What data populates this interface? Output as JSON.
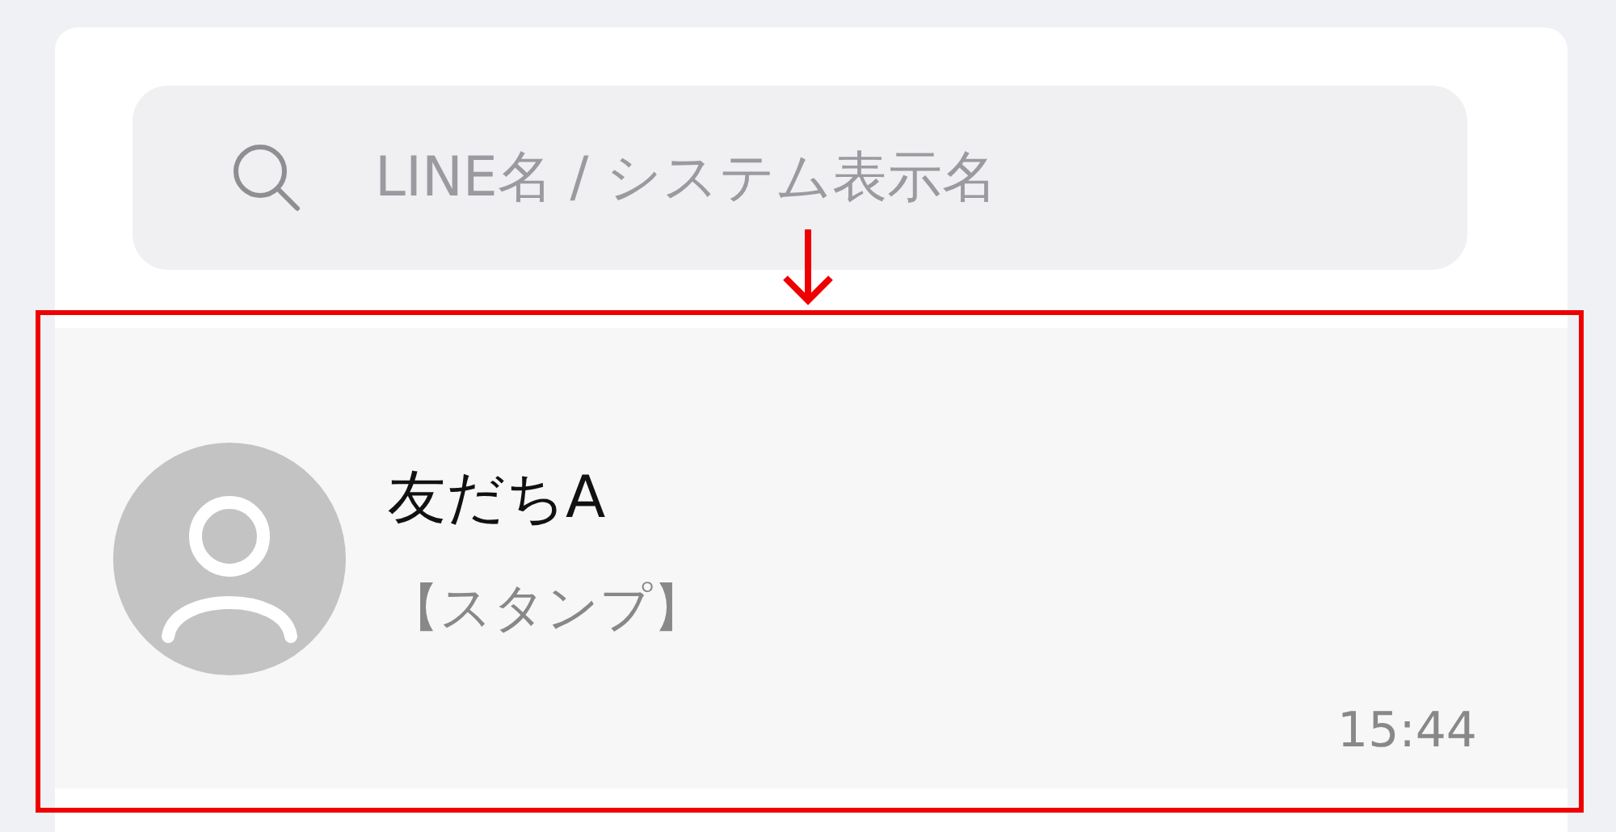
{
  "search": {
    "placeholder": "LINE名 / システム表示名"
  },
  "chats": [
    {
      "name": "友だちA",
      "message": "【スタンプ】",
      "time": "15:44"
    }
  ]
}
